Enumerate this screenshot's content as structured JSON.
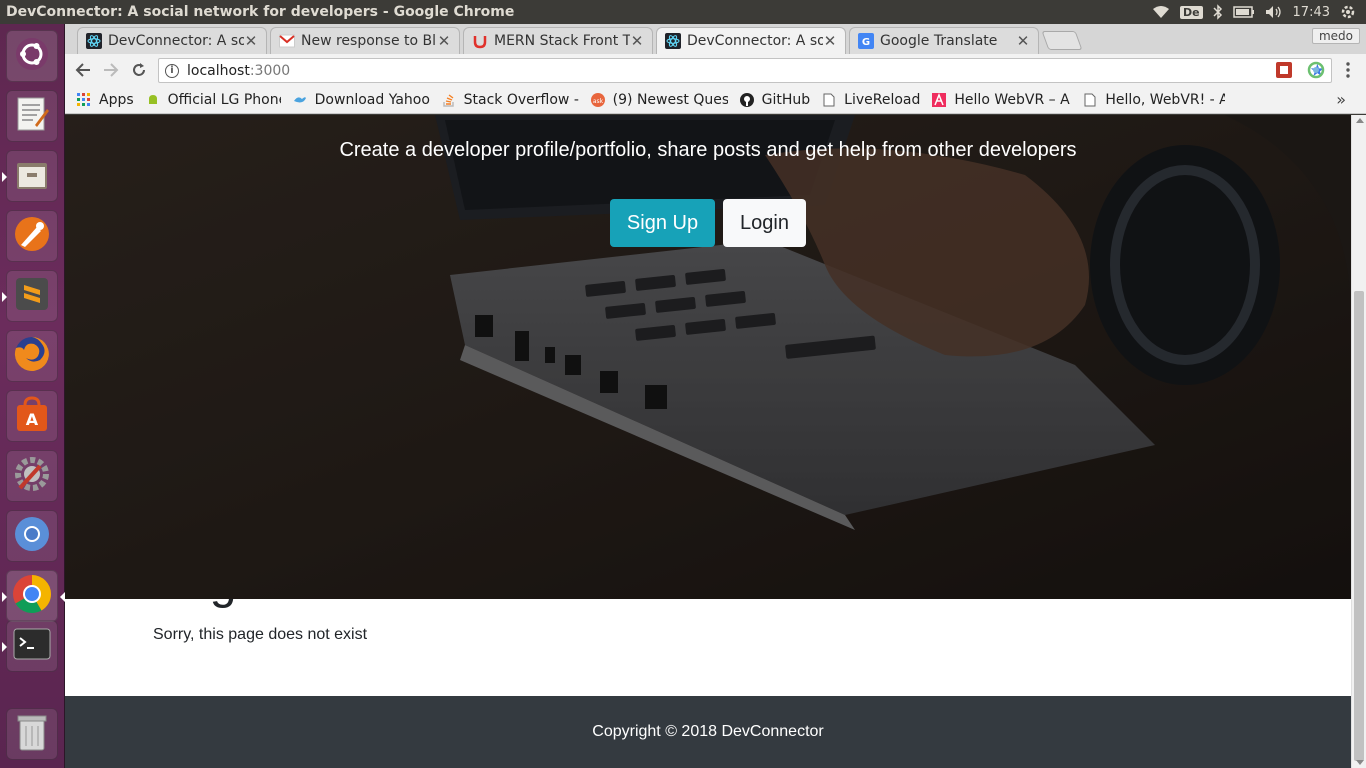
{
  "window": {
    "title": "DevConnector: A social network for developers - Google Chrome"
  },
  "system_tray": {
    "keyboard": "De",
    "clock": "17:43"
  },
  "launcher": {
    "apps": [
      {
        "name": "Ubuntu Dash",
        "icon": "ubuntu-logo-icon"
      },
      {
        "name": "Text Editor",
        "icon": "text-editor-icon"
      },
      {
        "name": "Files",
        "icon": "files-icon"
      },
      {
        "name": "Inkscape",
        "icon": "pen-tool-icon"
      },
      {
        "name": "Sublime Text",
        "icon": "sublime-icon"
      },
      {
        "name": "Firefox",
        "icon": "firefox-icon"
      },
      {
        "name": "Ubuntu Software",
        "icon": "software-center-icon"
      },
      {
        "name": "System Settings",
        "icon": "settings-icon"
      },
      {
        "name": "Chromium",
        "icon": "chromium-icon"
      },
      {
        "name": "Google Chrome",
        "icon": "chrome-icon"
      },
      {
        "name": "Terminal",
        "icon": "terminal-icon"
      },
      {
        "name": "Trash",
        "icon": "trash-icon"
      }
    ]
  },
  "tabs": [
    {
      "title": "DevConnector: A so",
      "icon": "react-icon",
      "active": false
    },
    {
      "title": "New response to Bl",
      "icon": "gmail-icon",
      "active": false
    },
    {
      "title": "MERN Stack Front T",
      "icon": "udemy-icon",
      "active": false
    },
    {
      "title": "DevConnector: A so",
      "icon": "react-icon",
      "active": true
    },
    {
      "title": "Google Translate",
      "icon": "translate-icon",
      "active": false
    }
  ],
  "profile_name": "medo",
  "address_bar": {
    "host": "localhost",
    "port": ":3000"
  },
  "bookmarks": [
    {
      "label": "Apps",
      "icon": "apps-grid-icon"
    },
    {
      "label": "Official LG Phone",
      "icon": "android-icon"
    },
    {
      "label": "Download Yahoo",
      "icon": "bird-icon"
    },
    {
      "label": "Stack Overflow -",
      "icon": "stackoverflow-icon"
    },
    {
      "label": "(9) Newest Ques",
      "icon": "ask-icon"
    },
    {
      "label": "GitHub",
      "icon": "github-icon"
    },
    {
      "label": "LiveReload",
      "icon": "page-icon"
    },
    {
      "label": "Hello WebVR – A",
      "icon": "webvr-icon"
    },
    {
      "label": "Hello, WebVR! - A",
      "icon": "page-icon"
    }
  ],
  "bookmarks_more": "»",
  "page": {
    "lead": "Create a developer profile/portfolio, share posts and get help from other developers",
    "signup_label": "Sign Up",
    "login_label": "Login",
    "not_found_title": "Page Not Found",
    "not_found_text": "Sorry, this page does not exist",
    "footer": "Copyright © 2018 DevConnector"
  },
  "colors": {
    "launcher": "#5e2750",
    "signup_button": "#17a2b8",
    "footer": "#343a40"
  }
}
